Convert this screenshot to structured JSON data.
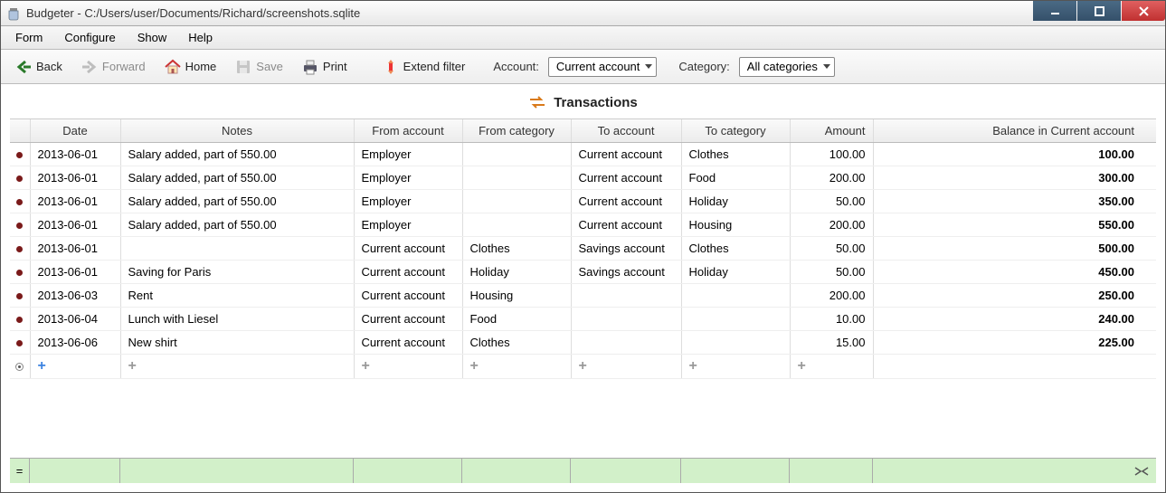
{
  "window": {
    "title": "Budgeter - C:/Users/user/Documents/Richard/screenshots.sqlite"
  },
  "menu": {
    "form": "Form",
    "configure": "Configure",
    "show": "Show",
    "help": "Help"
  },
  "toolbar": {
    "back": "Back",
    "forward": "Forward",
    "home": "Home",
    "save": "Save",
    "print": "Print",
    "extend_filter": "Extend filter",
    "account_label": "Account:",
    "account_value": "Current account",
    "category_label": "Category:",
    "category_value": "All categories"
  },
  "section": {
    "title": "Transactions"
  },
  "columns": {
    "date": "Date",
    "notes": "Notes",
    "from_account": "From account",
    "from_category": "From category",
    "to_account": "To account",
    "to_category": "To category",
    "amount": "Amount",
    "balance": "Balance in Current account"
  },
  "rows": [
    {
      "date": "2013-06-01",
      "notes": "Salary added, part of 550.00",
      "from_acc": "Employer",
      "from_cat": "",
      "to_acc": "Current account",
      "to_cat": "Clothes",
      "amount": "100.00",
      "balance": "100.00"
    },
    {
      "date": "2013-06-01",
      "notes": "Salary added, part of 550.00",
      "from_acc": "Employer",
      "from_cat": "",
      "to_acc": "Current account",
      "to_cat": "Food",
      "amount": "200.00",
      "balance": "300.00"
    },
    {
      "date": "2013-06-01",
      "notes": "Salary added, part of 550.00",
      "from_acc": "Employer",
      "from_cat": "",
      "to_acc": "Current account",
      "to_cat": "Holiday",
      "amount": "50.00",
      "balance": "350.00"
    },
    {
      "date": "2013-06-01",
      "notes": "Salary added, part of 550.00",
      "from_acc": "Employer",
      "from_cat": "",
      "to_acc": "Current account",
      "to_cat": "Housing",
      "amount": "200.00",
      "balance": "550.00"
    },
    {
      "date": "2013-06-01",
      "notes": "",
      "from_acc": "Current account",
      "from_cat": "Clothes",
      "to_acc": "Savings account",
      "to_cat": "Clothes",
      "amount": "50.00",
      "balance": "500.00"
    },
    {
      "date": "2013-06-01",
      "notes": "Saving for Paris",
      "from_acc": "Current account",
      "from_cat": "Holiday",
      "to_acc": "Savings account",
      "to_cat": "Holiday",
      "amount": "50.00",
      "balance": "450.00"
    },
    {
      "date": "2013-06-03",
      "notes": "Rent",
      "from_acc": "Current account",
      "from_cat": "Housing",
      "to_acc": "",
      "to_cat": "",
      "amount": "200.00",
      "balance": "250.00"
    },
    {
      "date": "2013-06-04",
      "notes": "Lunch with Liesel",
      "from_acc": "Current account",
      "from_cat": "Food",
      "to_acc": "",
      "to_cat": "",
      "amount": "10.00",
      "balance": "240.00"
    },
    {
      "date": "2013-06-06",
      "notes": "New shirt",
      "from_acc": "Current account",
      "from_cat": "Clothes",
      "to_acc": "",
      "to_cat": "",
      "amount": "15.00",
      "balance": "225.00"
    }
  ],
  "footer": {
    "eq": "="
  }
}
